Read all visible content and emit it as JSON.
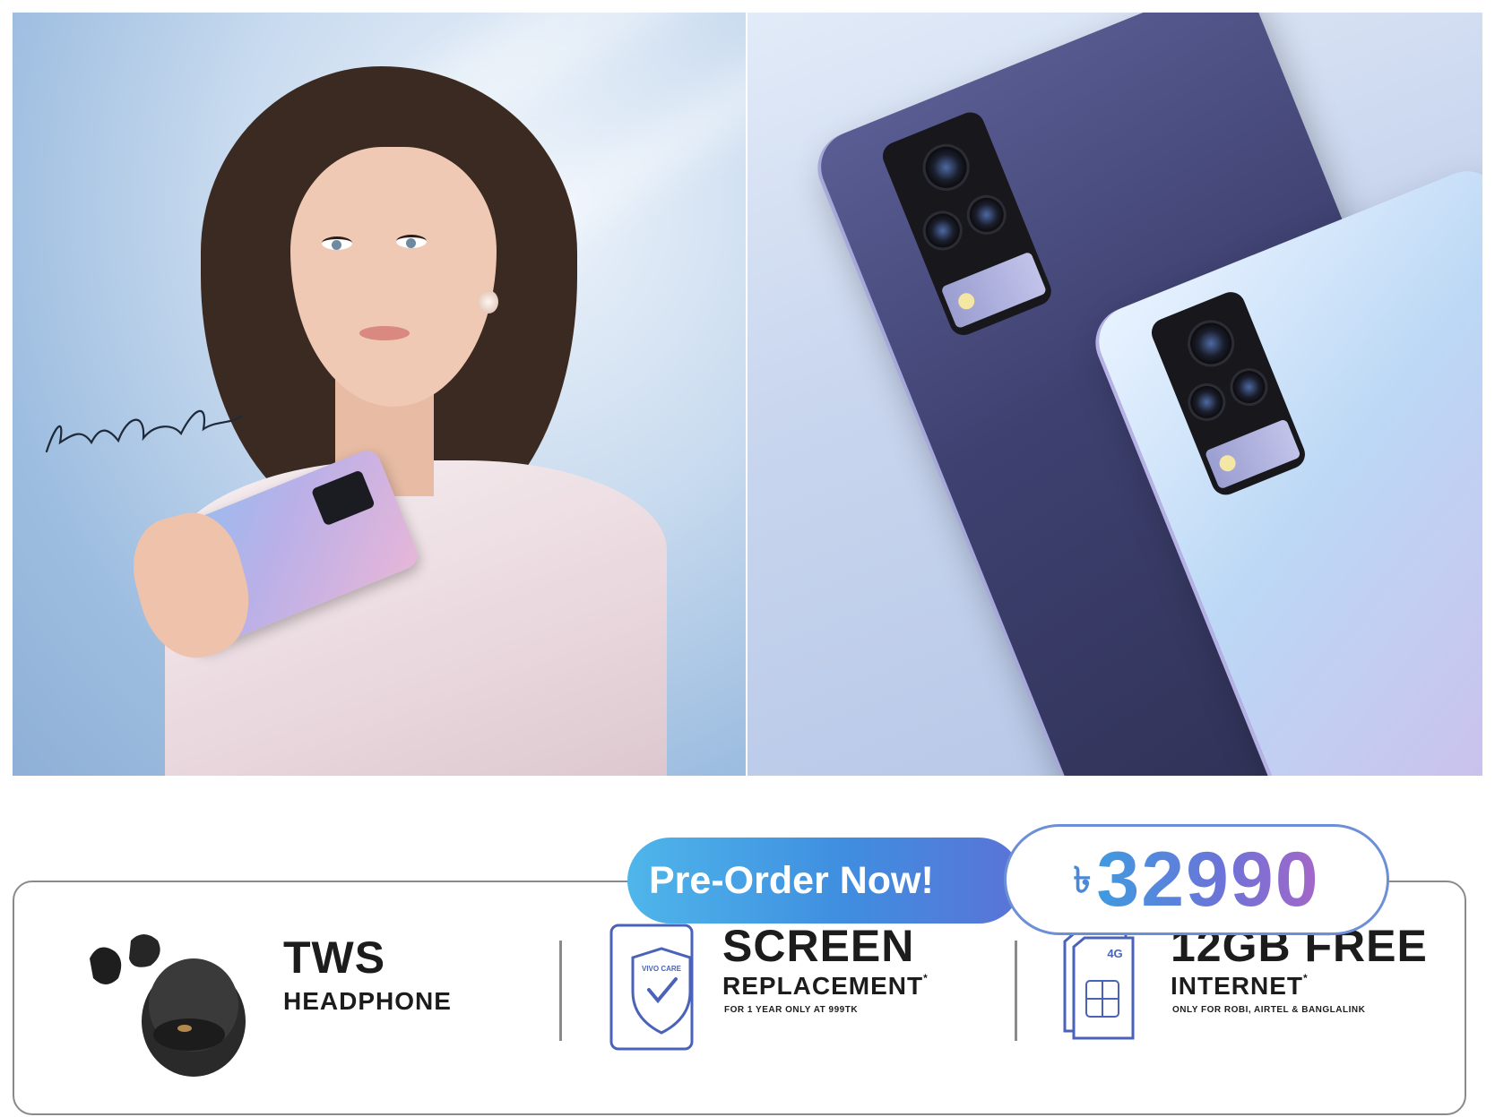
{
  "signature": "Bidya Sinha Mim",
  "offer_banner": {
    "preorder_label": "Pre-Order Now!",
    "currency_symbol": "৳",
    "price": "32990"
  },
  "offers": [
    {
      "title": "TWS",
      "subtitle": "HEADPHONE",
      "note": ""
    },
    {
      "title": "SCREEN",
      "subtitle": "REPLACEMENT",
      "asterisk": "*",
      "note": "FOR 1 YEAR ONLY AT 999TK",
      "badge_text": "VIVO CARE"
    },
    {
      "title": "12GB FREE",
      "subtitle": "INTERNET",
      "asterisk": "*",
      "note": "ONLY FOR ROBI, AIRTEL & BANGLALINK",
      "sim_label": "4G"
    }
  ],
  "colors": {
    "preorder_gradient": [
      "#4fb6ea",
      "#5b73d7"
    ],
    "price_gradient": [
      "#3f9be0",
      "#a566c8"
    ],
    "text_dark": "#1c1c1c"
  }
}
